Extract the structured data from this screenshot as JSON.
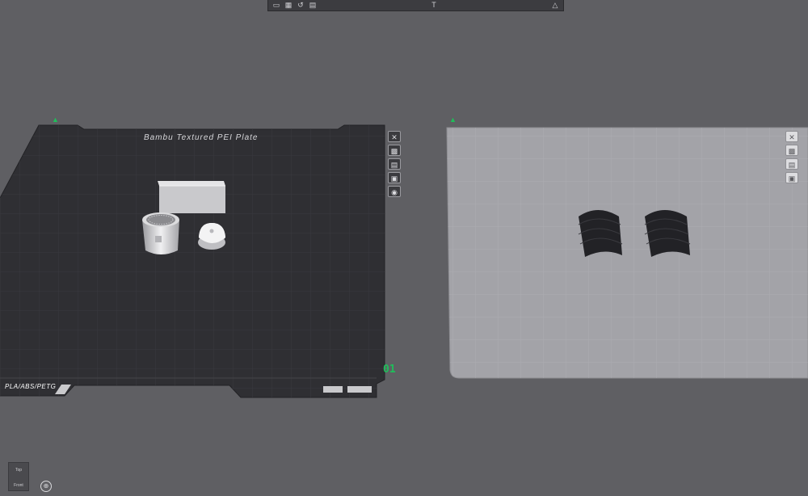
{
  "toolbar": {
    "left_icons": [
      "import-icon",
      "arrange-icon",
      "orient-icon",
      "plate-settings-icon"
    ],
    "center_icon": "text-tool-icon",
    "right_icon": "assembly-view-icon"
  },
  "plate1": {
    "title": "Bambu Textured PEI Plate",
    "number": "01",
    "material_text": "PLA/ABS/PETG",
    "tools": [
      "close-icon",
      "image-icon",
      "layout-icon",
      "lock-icon",
      "eye-icon"
    ]
  },
  "plate2": {
    "tools": [
      "close-icon",
      "image-icon",
      "layout-icon",
      "lock-icon"
    ]
  },
  "view_cube": {
    "top": "Top",
    "front": "Front"
  },
  "colors": {
    "background": "#5f5f63",
    "plate_active": "#2f2f33",
    "plate_inactive": "#9e9ea3",
    "accent": "#1fbe5a"
  }
}
